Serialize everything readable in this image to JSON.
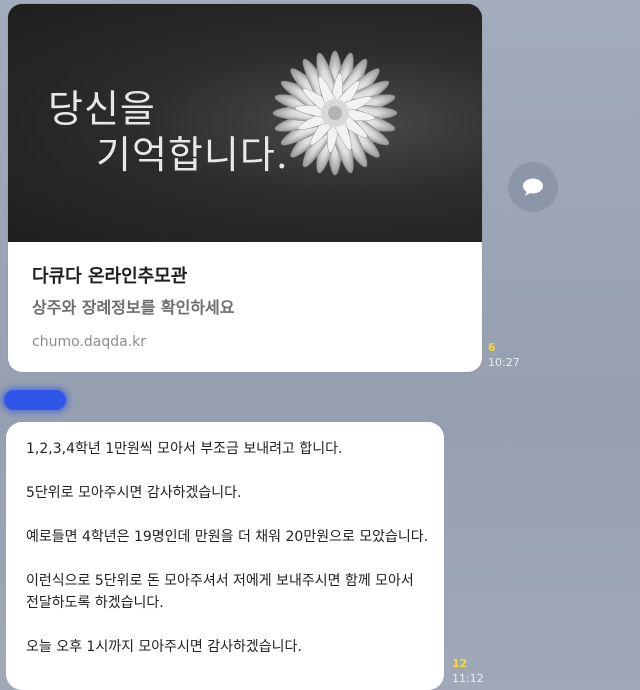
{
  "chat": {
    "link_preview": {
      "image_headline_line1": "당신을",
      "image_headline_line2": "기억합니다.",
      "title": "다큐다 온라인추모관",
      "description": "상주와 장례정보를 확인하세요",
      "domain": "chumo.daqda.kr",
      "image_icon": "white-chrysanthemum-icon",
      "unread_count": "6",
      "time": "10:27"
    },
    "share_icon": "speech-bubble-icon",
    "sender_name": "",
    "message": {
      "lines": [
        "1,2,3,4학년 1만원씩 모아서 부조금 보내려고 합니다.",
        "5단위로 모아주시면 감사하겠습니다.",
        "예로들면 4학년은 19명인데 만원을 더 채워 20만원으로 모았습니다.",
        "이런식으로 5단위로 돈 모아주셔서 저에게 보내주시면 함께 모아서",
        "전달하도록 하겠습니다.",
        "오늘 오후 1시까지 모아주시면 감사하겠습니다."
      ],
      "unread_count": "12",
      "time": "11:12"
    }
  },
  "colors": {
    "background": "#9aa3b4",
    "bubble": "#ffffff",
    "unread": "#f5d93a",
    "sender_highlight": "#2f56e8"
  }
}
